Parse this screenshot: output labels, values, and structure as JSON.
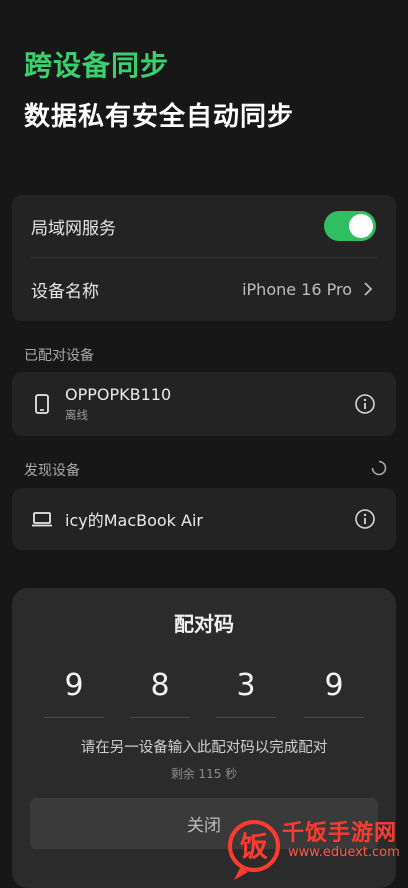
{
  "header": {
    "title": "跨设备同步",
    "subtitle": "数据私有安全自动同步"
  },
  "settings": {
    "lan_service_label": "局域网服务",
    "lan_service_enabled": true,
    "device_name_label": "设备名称",
    "device_name_value": "iPhone 16 Pro"
  },
  "paired": {
    "section_label": "已配对设备",
    "devices": [
      {
        "name": "OPPOPKB110",
        "status": "离线",
        "icon": "phone-icon"
      }
    ]
  },
  "discovered": {
    "section_label": "发现设备",
    "devices": [
      {
        "name": "icy的MacBook Air",
        "icon": "laptop-icon"
      }
    ]
  },
  "pairing_sheet": {
    "title": "配对码",
    "digits": [
      "9",
      "8",
      "3",
      "9"
    ],
    "hint": "请在另一设备输入此配对码以完成配对",
    "remaining": "剩余 115 秒",
    "close_label": "关闭"
  },
  "watermark": {
    "logo_char": "饭",
    "name": "千饭手游网",
    "url": "www.eduext.com"
  },
  "colors": {
    "accent_green": "#3ccf6e",
    "toggle_on": "#2fbe62",
    "watermark_red": "#ff3b2f"
  }
}
